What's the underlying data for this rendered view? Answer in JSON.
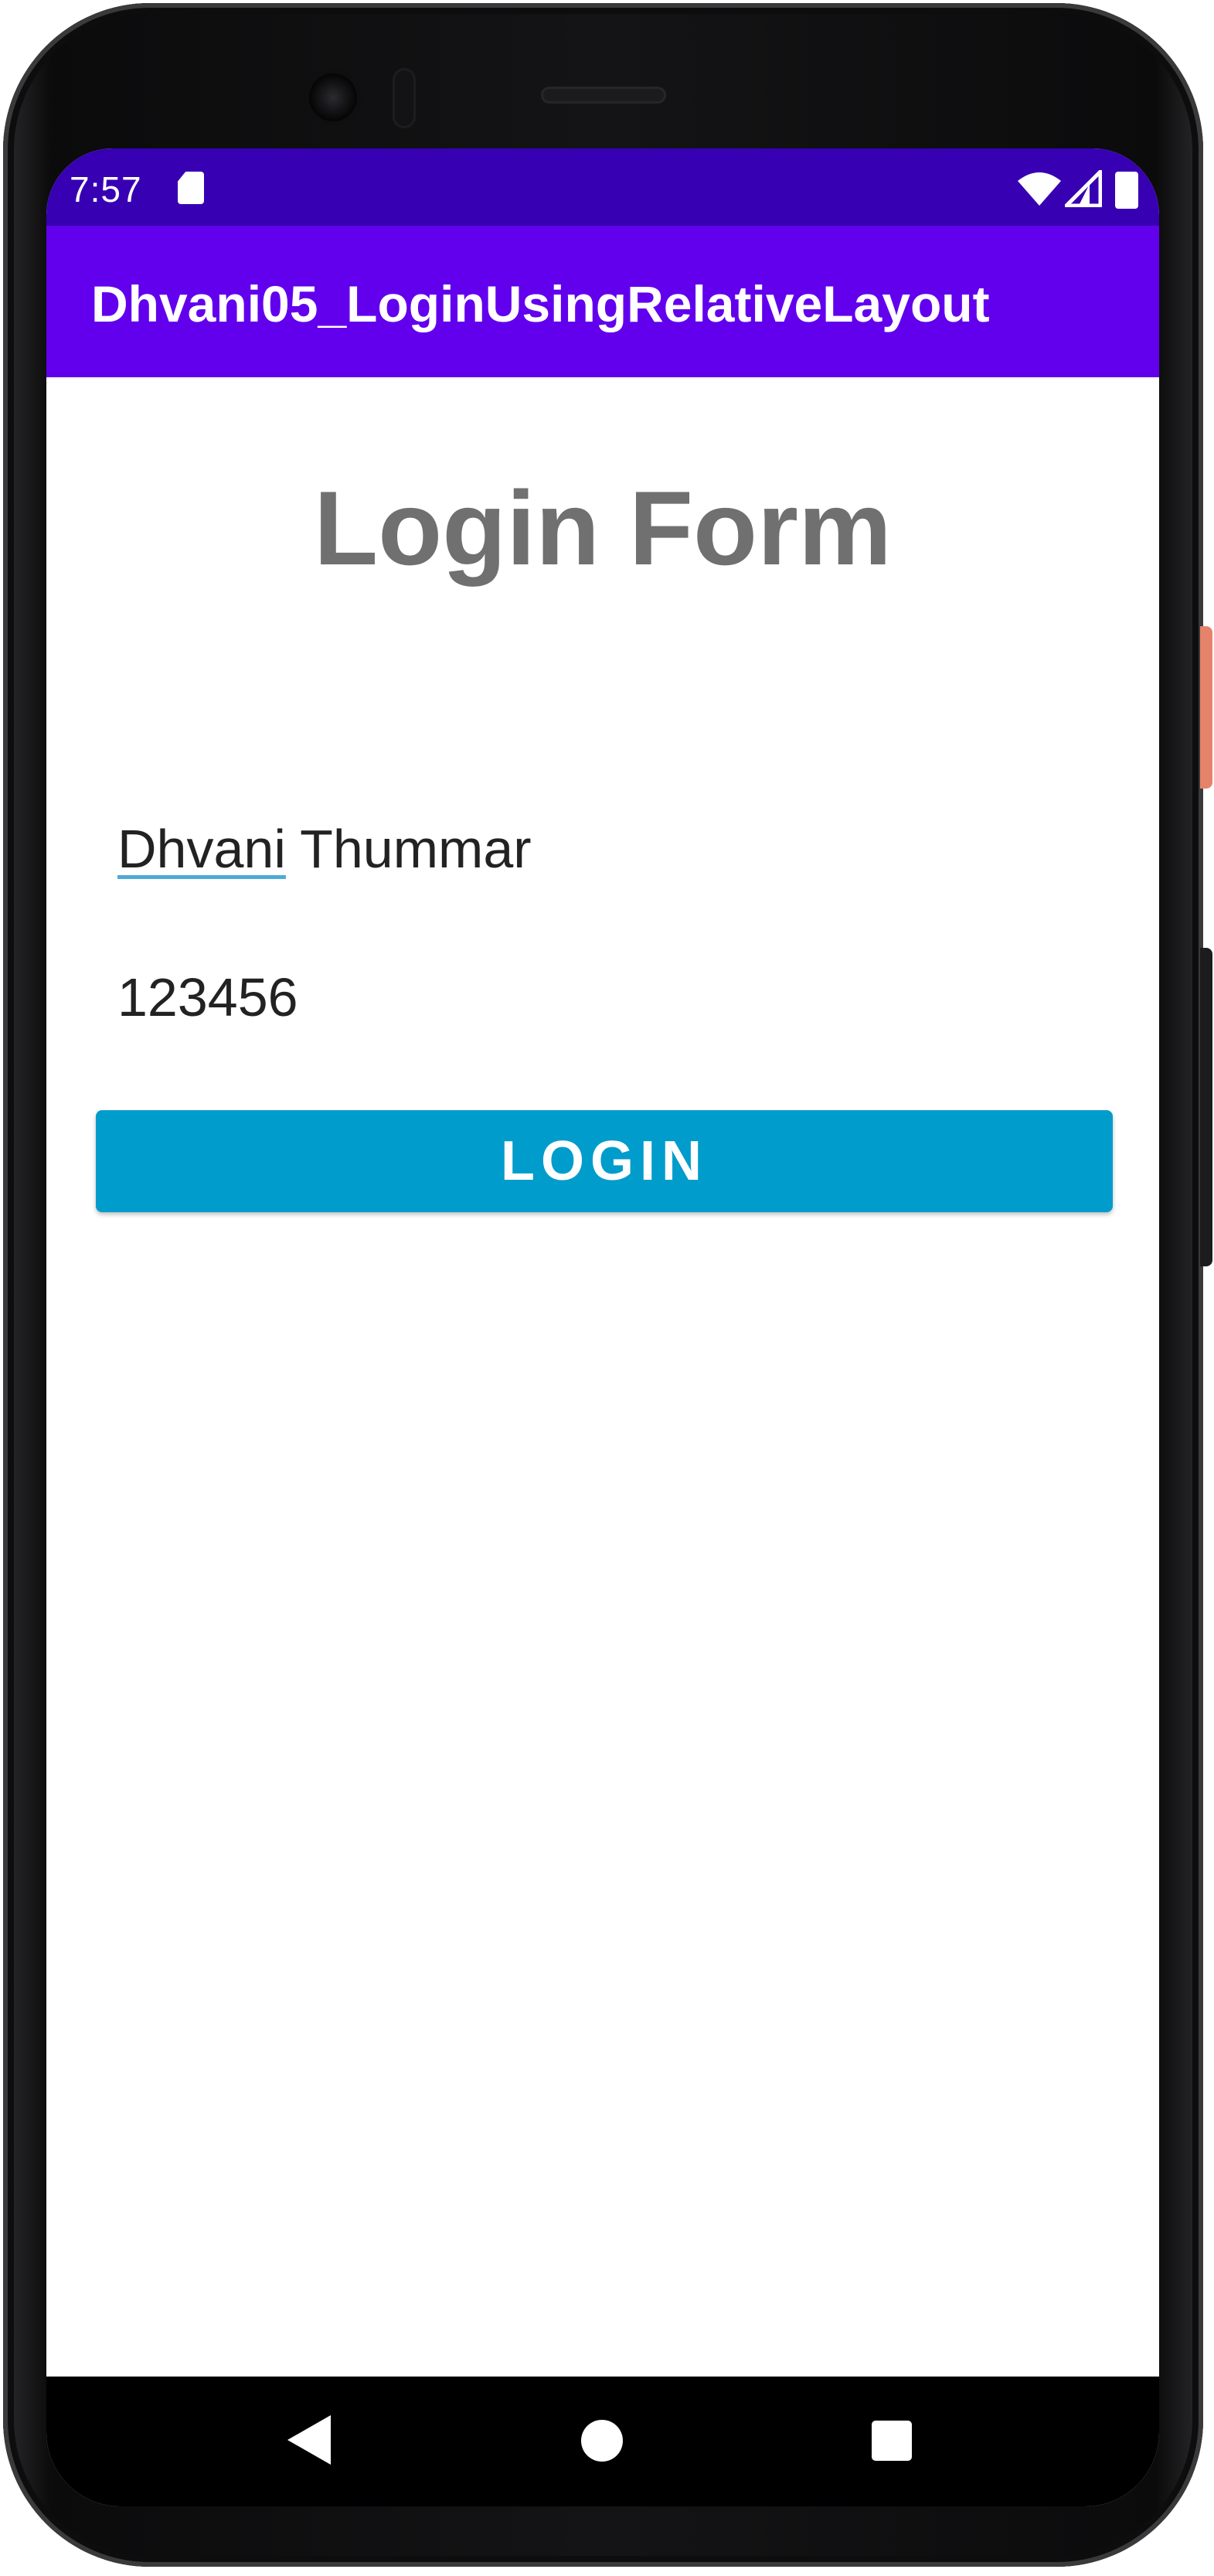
{
  "status_bar": {
    "time": "7:57",
    "icons": [
      "sd-card-icon",
      "wifi-icon",
      "cell-signal-icon",
      "battery-icon"
    ]
  },
  "app_bar": {
    "title": "Dhvani05_LoginUsingRelativeLayout"
  },
  "form": {
    "heading": "Login Form",
    "username_first": "Dhvani",
    "username_rest": " Thummar",
    "password": "123456",
    "login_label": "LOGIN"
  },
  "nav_bar": {
    "icons": [
      "back-icon",
      "home-icon",
      "recents-icon"
    ]
  },
  "colors": {
    "status_bar": "#3700b3",
    "app_bar": "#6200ee",
    "button": "#009ccc",
    "heading_text": "#707070",
    "spellcheck_underline": "#4fa9d6"
  }
}
